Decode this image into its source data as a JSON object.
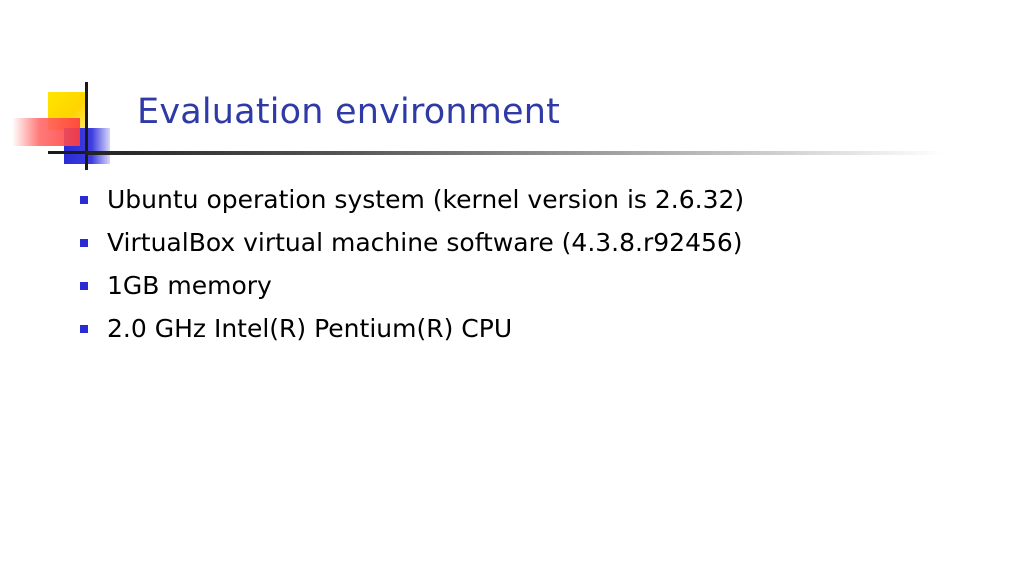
{
  "slide": {
    "title": "Evaluation environment",
    "bullets": [
      "Ubuntu operation system (kernel version is 2.6.32)",
      "VirtualBox virtual machine software (4.3.8.r92456)",
      "1GB memory",
      "2.0 GHz Intel(R) Pentium(R) CPU"
    ]
  },
  "colors": {
    "title": "#2f3aa6",
    "bullet_marker": "#2b2bd6",
    "accent_yellow": "#ffd400",
    "accent_red": "#ff3b3b",
    "accent_blue": "#2b2bd6"
  }
}
